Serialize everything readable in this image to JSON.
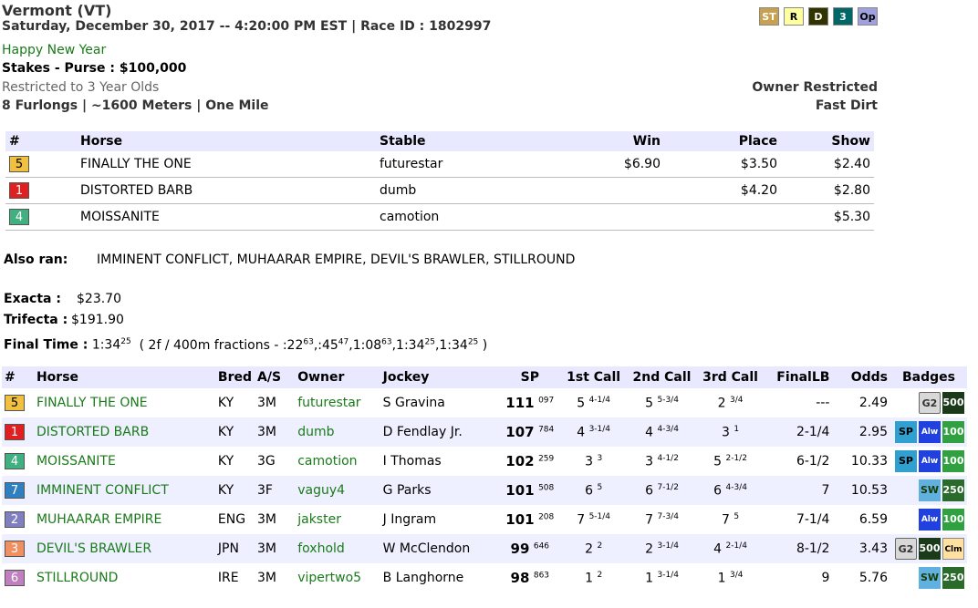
{
  "header": {
    "track": "Vermont (VT)",
    "date_line": "Saturday, December 30, 2017 -- 4:20:00 PM EST | Race ID : 1802997",
    "race_name": "Happy New Year",
    "stakes_label": "Stakes - Purse :",
    "purse": "$100,000",
    "restriction": "Restricted to 3 Year Olds",
    "distance": "8 Furlongs | ~1600 Meters | One Mile",
    "owner_restriction": "Owner Restricted",
    "surface": "Fast Dirt",
    "type_badges": [
      {
        "label": "ST",
        "bg": "#c8a050",
        "fg": "#fff"
      },
      {
        "label": "R",
        "bg": "#ffffa0",
        "fg": "#000"
      },
      {
        "label": "D",
        "bg": "#333300",
        "fg": "#fff"
      },
      {
        "label": "3",
        "bg": "#006666",
        "fg": "#fff"
      },
      {
        "label": "Op",
        "bg": "#a0a0e0",
        "fg": "#000"
      }
    ]
  },
  "results": {
    "headers": [
      "#",
      "Horse",
      "Stable",
      "Win",
      "Place",
      "Show"
    ],
    "rows": [
      {
        "pgm": "5",
        "pgm_bg": "#f0c040",
        "pgm_fg": "#000",
        "horse": "FINALLY THE ONE",
        "stable": "futurestar",
        "win": "$6.90",
        "place": "$3.50",
        "show": "$2.40"
      },
      {
        "pgm": "1",
        "pgm_bg": "#e02020",
        "pgm_fg": "#fff",
        "horse": "DISTORTED BARB",
        "stable": "dumb",
        "win": "",
        "place": "$4.20",
        "show": "$2.80"
      },
      {
        "pgm": "4",
        "pgm_bg": "#40b080",
        "pgm_fg": "#fff",
        "horse": "MOISSANITE",
        "stable": "camotion",
        "win": "",
        "place": "",
        "show": "$5.30"
      }
    ]
  },
  "also_ran": {
    "label": "Also ran:",
    "value": "IMMINENT CONFLICT, MUHAARAR EMPIRE, DEVIL'S BRAWLER, STILLROUND"
  },
  "exotics": {
    "exacta_label": "Exacta :",
    "exacta": "$23.70",
    "trifecta_label": "Trifecta :",
    "trifecta": "$191.90",
    "final_time_label": "Final Time :",
    "final_time": "1:34",
    "final_time_sup": "25",
    "fractions_prefix": "( 2f / 400m fractions - :22",
    "fractions": [
      {
        "t": ":22",
        "s": "63"
      },
      {
        "t": ",:45",
        "s": "47"
      },
      {
        "t": ",1:08",
        "s": "63"
      },
      {
        "t": ",1:34",
        "s": "25"
      },
      {
        "t": ",1:34",
        "s": "25"
      }
    ]
  },
  "full": {
    "headers": [
      "#",
      "Horse",
      "Bred",
      "A/S",
      "Owner",
      "Jockey",
      "SP",
      "1st Call",
      "2nd Call",
      "3rd Call",
      "FinalLB",
      "Odds",
      "Badges"
    ],
    "rows": [
      {
        "pgm": "5",
        "pgm_bg": "#f0c040",
        "pgm_fg": "#000",
        "horse": "FINALLY THE ONE",
        "bred": "KY",
        "as": "3M",
        "owner": "futurestar",
        "jockey": "S Gravina",
        "sp": "111",
        "sp_sup": "097",
        "c1": "5",
        "c1s": "4-1/4",
        "c2": "5",
        "c2s": "5-3/4",
        "c3": "2",
        "c3s": "3/4",
        "final": "---",
        "odds": "2.49",
        "badges": [
          "G2",
          "500"
        ]
      },
      {
        "pgm": "1",
        "pgm_bg": "#e02020",
        "pgm_fg": "#fff",
        "horse": "DISTORTED BARB",
        "bred": "KY",
        "as": "3M",
        "owner": "dumb",
        "jockey": "D Fendlay Jr.",
        "sp": "107",
        "sp_sup": "784",
        "c1": "4",
        "c1s": "3-1/4",
        "c2": "4",
        "c2s": "4-3/4",
        "c3": "3",
        "c3s": "1",
        "final": "2-1/4",
        "odds": "2.95",
        "badges": [
          "SP",
          "Alw",
          "100"
        ]
      },
      {
        "pgm": "4",
        "pgm_bg": "#40b080",
        "pgm_fg": "#fff",
        "horse": "MOISSANITE",
        "bred": "KY",
        "as": "3G",
        "owner": "camotion",
        "jockey": "I Thomas",
        "sp": "102",
        "sp_sup": "259",
        "c1": "3",
        "c1s": "3",
        "c2": "3",
        "c2s": "4-1/2",
        "c3": "5",
        "c3s": "2-1/2",
        "final": "6-1/2",
        "odds": "10.33",
        "badges": [
          "SP",
          "Alw",
          "100"
        ]
      },
      {
        "pgm": "7",
        "pgm_bg": "#3080c0",
        "pgm_fg": "#fff",
        "horse": "IMMINENT CONFLICT",
        "bred": "KY",
        "as": "3F",
        "owner": "vaguy4",
        "jockey": "G Parks",
        "sp": "101",
        "sp_sup": "508",
        "c1": "6",
        "c1s": "5",
        "c2": "6",
        "c2s": "7-1/2",
        "c3": "6",
        "c3s": "4-3/4",
        "final": "7",
        "odds": "10.53",
        "badges": [
          "SW",
          "250"
        ]
      },
      {
        "pgm": "2",
        "pgm_bg": "#8080c0",
        "pgm_fg": "#fff",
        "horse": "MUHAARAR EMPIRE",
        "bred": "ENG",
        "as": "3M",
        "owner": "jakster",
        "jockey": "J Ingram",
        "sp": "101",
        "sp_sup": "208",
        "c1": "7",
        "c1s": "5-1/4",
        "c2": "7",
        "c2s": "7-3/4",
        "c3": "7",
        "c3s": "5",
        "final": "7-1/4",
        "odds": "6.59",
        "badges": [
          "Alw",
          "100"
        ]
      },
      {
        "pgm": "3",
        "pgm_bg": "#f09060",
        "pgm_fg": "#fff",
        "horse": "DEVIL'S BRAWLER",
        "bred": "JPN",
        "as": "3M",
        "owner": "foxhold",
        "jockey": "W McClendon",
        "sp": "99",
        "sp_sup": "646",
        "c1": "2",
        "c1s": "2",
        "c2": "2",
        "c2s": "3-1/4",
        "c3": "4",
        "c3s": "2-1/4",
        "final": "8-1/2",
        "odds": "3.43",
        "badges": [
          "G2",
          "500",
          "Clm"
        ]
      },
      {
        "pgm": "6",
        "pgm_bg": "#c080c0",
        "pgm_fg": "#fff",
        "horse": "STILLROUND",
        "bred": "IRE",
        "as": "3M",
        "owner": "vipertwo5",
        "jockey": "B Langhorne",
        "sp": "98",
        "sp_sup": "863",
        "c1": "1",
        "c1s": "2",
        "c2": "1",
        "c2s": "3-1/4",
        "c3": "1",
        "c3s": "3/4",
        "final": "9",
        "odds": "5.76",
        "badges": [
          "SW",
          "250"
        ]
      }
    ]
  }
}
